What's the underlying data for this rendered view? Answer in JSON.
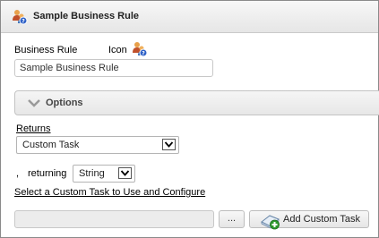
{
  "window": {
    "title": "Sample Business Rule"
  },
  "form": {
    "business_rule_label": "Business Rule",
    "icon_label": "Icon",
    "name_value": "Sample Business Rule"
  },
  "options": {
    "label": "Options"
  },
  "returns": {
    "label": "Returns",
    "selected": "Custom Task"
  },
  "returning": {
    "comma": ",",
    "label": "returning",
    "selected": "String"
  },
  "custom_task": {
    "link_text": "Select a Custom Task to Use and Configure",
    "input_value": "",
    "browse_label": "...",
    "add_label": "Add Custom Task"
  },
  "icons": {
    "title": "business-rule-icon",
    "rule": "business-rule-icon",
    "options": "chevron-down-icon",
    "add": "add-task-icon"
  }
}
